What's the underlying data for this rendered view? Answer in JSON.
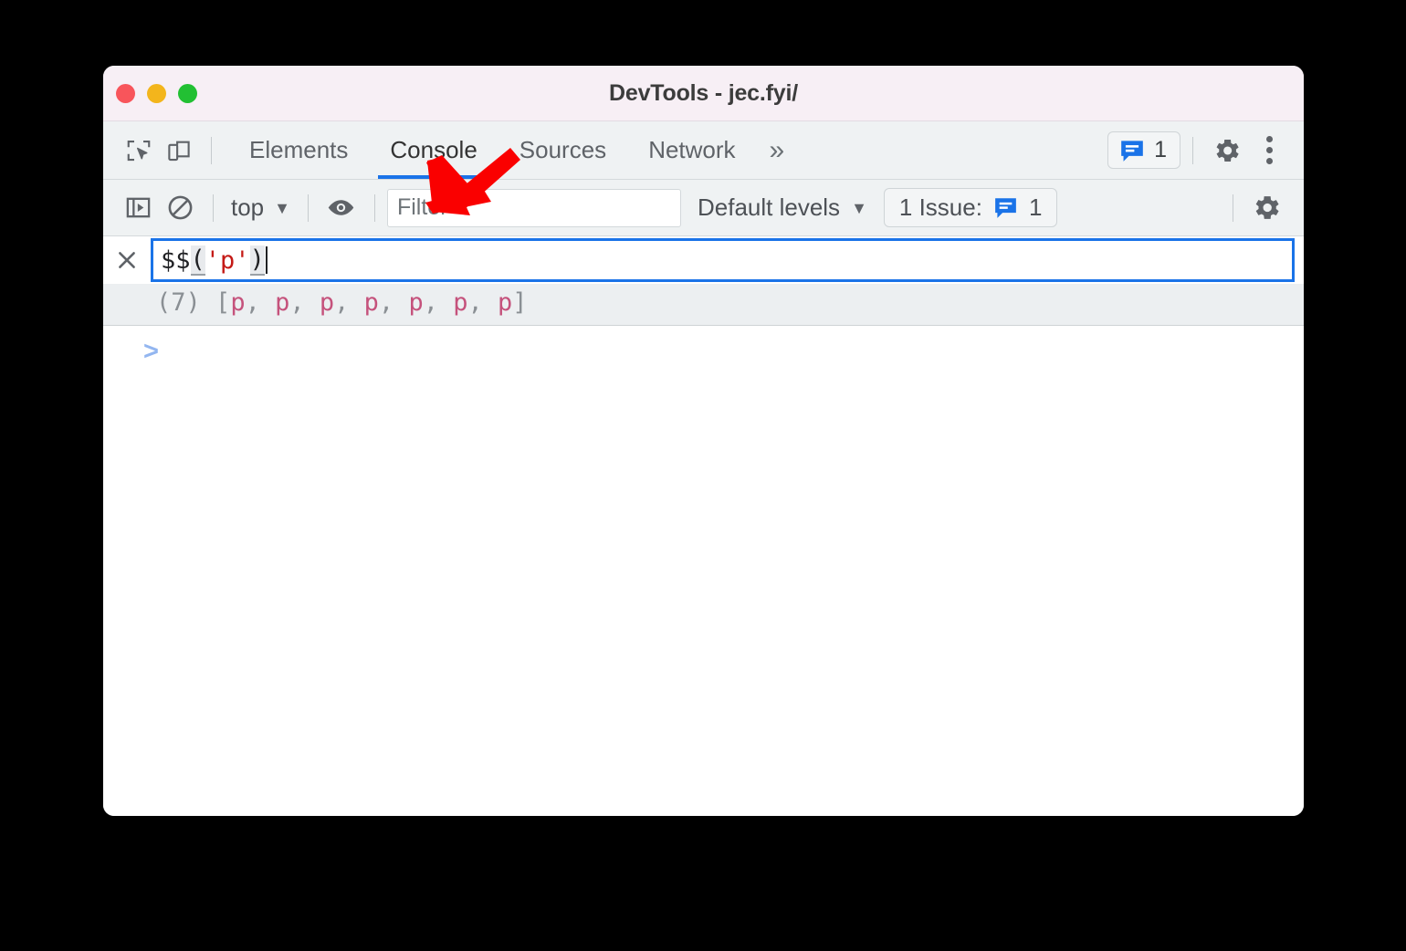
{
  "window": {
    "title": "DevTools - jec.fyi/",
    "traffic_lights": [
      {
        "name": "close",
        "color": "#f8555b"
      },
      {
        "name": "minimize",
        "color": "#f3b51c"
      },
      {
        "name": "maximize",
        "color": "#22c033"
      }
    ]
  },
  "tabbar": {
    "inspect_icon": "inspect-element-icon",
    "device_icon": "device-toolbar-icon",
    "tabs": [
      {
        "label": "Elements",
        "active": false
      },
      {
        "label": "Console",
        "active": true
      },
      {
        "label": "Sources",
        "active": false
      },
      {
        "label": "Network",
        "active": false
      }
    ],
    "more_tabs_label": "»",
    "issues_badge": {
      "icon": "message-icon",
      "count": "1"
    },
    "settings_icon": "gear-icon",
    "more_options_icon": "three-dot-menu-icon",
    "active_tab_underline_color": "#1a73e8"
  },
  "console_toolbar": {
    "sidebar_icon": "console-sidebar-icon",
    "clear_icon": "clear-console-icon",
    "context": {
      "label": "top",
      "caret": "▼"
    },
    "live_expression_icon": "eye-icon",
    "filter": {
      "placeholder": "Filter",
      "value": ""
    },
    "levels": {
      "label": "Default levels",
      "caret": "▼"
    },
    "issues": {
      "label": "1 Issue:",
      "icon": "message-icon",
      "count": "1"
    },
    "settings_icon": "gear-icon"
  },
  "console": {
    "clear_entry_icon": "close-icon",
    "input": {
      "tokens": [
        {
          "text": "$$",
          "type": "fn"
        },
        {
          "text": "(",
          "type": "paren"
        },
        {
          "text": "'p'",
          "type": "str"
        },
        {
          "text": ")",
          "type": "paren"
        }
      ],
      "value": "$$('p')"
    },
    "result": {
      "count": "(7)",
      "open": "[",
      "close": "]",
      "separator": ", ",
      "items": [
        "p",
        "p",
        "p",
        "p",
        "p",
        "p",
        "p"
      ]
    },
    "prompt": ">"
  },
  "annotation": {
    "arrow_color": "#fa0000",
    "arrow_direction": "down-left",
    "points_at": "console-tab"
  }
}
